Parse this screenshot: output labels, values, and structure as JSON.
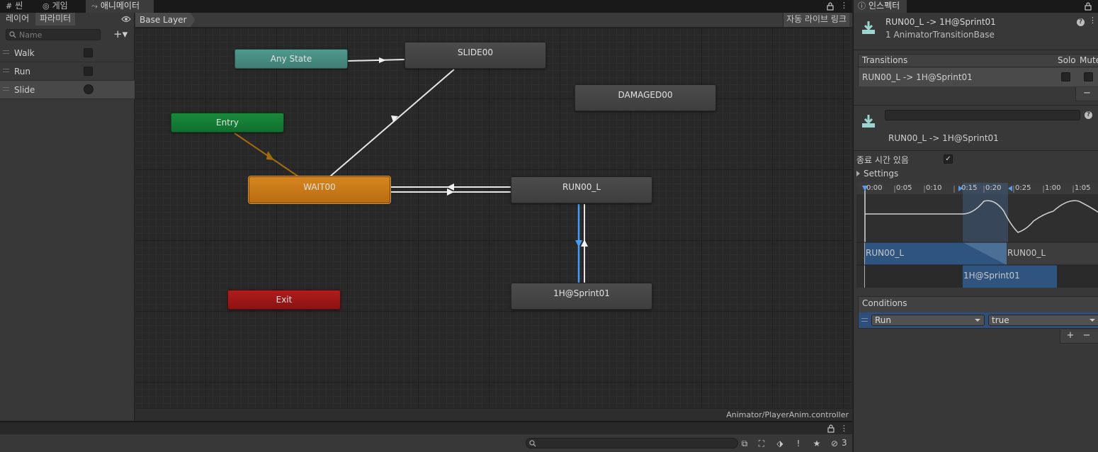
{
  "tabs": [
    {
      "label": "씬",
      "icon": "grid-icon"
    },
    {
      "label": "게임",
      "icon": "gamepad-icon"
    },
    {
      "label": "애니메이터",
      "icon": "animator-icon"
    }
  ],
  "left_panel": {
    "tabs": [
      "레이어",
      "파라미터"
    ],
    "search_placeholder": "Name",
    "add_label": "+▾",
    "parameters": [
      {
        "name": "Walk",
        "type": "bool"
      },
      {
        "name": "Run",
        "type": "bool"
      },
      {
        "name": "Slide",
        "type": "trigger"
      }
    ]
  },
  "graph": {
    "breadcrumb": "Base Layer",
    "auto_live_link": "자동 라이브 링크",
    "controller_path": "Animator/PlayerAnim.controller",
    "states": {
      "any_state": "Any State",
      "slide": "SLIDE00",
      "damaged": "DAMAGED00",
      "entry": "Entry",
      "wait": "WAIT00",
      "run": "RUN00_L",
      "exit": "Exit",
      "sprint": "1H@Sprint01"
    }
  },
  "bottom": {
    "hidden_count": "3"
  },
  "inspector": {
    "tab_label": "인스펙터",
    "title": "RUN00_L -> 1H@Sprint01",
    "subtitle": "1 AnimatorTransitionBase",
    "transitions_title": "Transitions",
    "solo_label": "Solo",
    "mute_label": "Mute",
    "transition_row": "RUN00_L -> 1H@Sprint01",
    "remove_label": "−",
    "transition_name": "RUN00_L -> 1H@Sprint01",
    "has_exit_time_label": "종료 시간 있음",
    "has_exit_time_checkmark": "✓",
    "settings_label": "Settings",
    "timeline_ticks": [
      "0:00",
      "0:05",
      "0:10",
      "0:15",
      "0:20",
      "0:25",
      "1:00",
      "1:05"
    ],
    "clip_a": "RUN00_L",
    "clip_a_repeat": "RUN00_L",
    "clip_b": "1H@Sprint01",
    "conditions_title": "Conditions",
    "condition": {
      "parameter": "Run",
      "value": "true"
    },
    "add_label": "+",
    "remove_condition_label": "−"
  },
  "colors": {
    "any_state": "#4a9184",
    "entry": "#168535",
    "default_state": "#c8781a",
    "exit": "#a11818",
    "selected_transition": "#4a9cf0",
    "condition_row": "#2d4f7a"
  }
}
